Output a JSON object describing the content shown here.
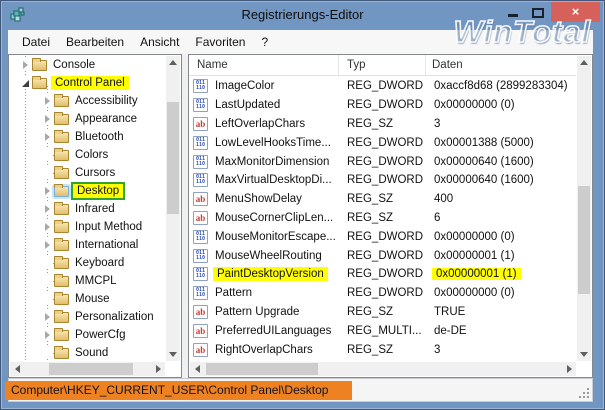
{
  "window": {
    "title": "Registrierungs-Editor",
    "watermark": "WinTotal",
    "controls": {
      "minimize": "minimize",
      "maximize": "maximize",
      "close": "×"
    }
  },
  "menu": {
    "items": [
      "Datei",
      "Bearbeiten",
      "Ansicht",
      "Favoriten",
      "?"
    ]
  },
  "tree": {
    "items": [
      {
        "label": "Console",
        "level": 1,
        "expand": "collapsed"
      },
      {
        "label": "Control Panel",
        "level": 1,
        "expand": "expanded",
        "highlight": true
      },
      {
        "label": "Accessibility",
        "level": 2,
        "expand": "collapsed"
      },
      {
        "label": "Appearance",
        "level": 2,
        "expand": "collapsed"
      },
      {
        "label": "Bluetooth",
        "level": 2,
        "expand": "collapsed"
      },
      {
        "label": "Colors",
        "level": 2,
        "expand": "none"
      },
      {
        "label": "Cursors",
        "level": 2,
        "expand": "none"
      },
      {
        "label": "Desktop",
        "level": 2,
        "expand": "collapsed",
        "highlight": true,
        "outlined": true,
        "selected": true
      },
      {
        "label": "Infrared",
        "level": 2,
        "expand": "collapsed"
      },
      {
        "label": "Input Method",
        "level": 2,
        "expand": "collapsed"
      },
      {
        "label": "International",
        "level": 2,
        "expand": "collapsed"
      },
      {
        "label": "Keyboard",
        "level": 2,
        "expand": "none"
      },
      {
        "label": "MMCPL",
        "level": 2,
        "expand": "none"
      },
      {
        "label": "Mouse",
        "level": 2,
        "expand": "none"
      },
      {
        "label": "Personalization",
        "level": 2,
        "expand": "collapsed"
      },
      {
        "label": "PowerCfg",
        "level": 2,
        "expand": "collapsed"
      },
      {
        "label": "Sound",
        "level": 2,
        "expand": "none"
      }
    ]
  },
  "list": {
    "columns": [
      "Name",
      "Typ",
      "Daten"
    ],
    "rows": [
      {
        "icon": "dword",
        "name": "ImageColor",
        "type": "REG_DWORD",
        "data": "0xaccf8d68 (2899283304)"
      },
      {
        "icon": "dword",
        "name": "LastUpdated",
        "type": "REG_DWORD",
        "data": "0x00000000 (0)"
      },
      {
        "icon": "sz",
        "name": "LeftOverlapChars",
        "type": "REG_SZ",
        "data": "3"
      },
      {
        "icon": "dword",
        "name": "LowLevelHooksTime...",
        "type": "REG_DWORD",
        "data": "0x00001388 (5000)"
      },
      {
        "icon": "dword",
        "name": "MaxMonitorDimension",
        "type": "REG_DWORD",
        "data": "0x00000640 (1600)"
      },
      {
        "icon": "dword",
        "name": "MaxVirtualDesktopDi...",
        "type": "REG_DWORD",
        "data": "0x00000640 (1600)"
      },
      {
        "icon": "sz",
        "name": "MenuShowDelay",
        "type": "REG_SZ",
        "data": "400"
      },
      {
        "icon": "sz",
        "name": "MouseCornerClipLen...",
        "type": "REG_SZ",
        "data": "6"
      },
      {
        "icon": "dword",
        "name": "MouseMonitorEscape...",
        "type": "REG_DWORD",
        "data": "0x00000000 (0)"
      },
      {
        "icon": "dword",
        "name": "MouseWheelRouting",
        "type": "REG_DWORD",
        "data": "0x00000001 (1)"
      },
      {
        "icon": "dword",
        "name": "PaintDesktopVersion",
        "type": "REG_DWORD",
        "data": "0x00000001 (1)",
        "highlight_name": true,
        "highlight_data": true
      },
      {
        "icon": "dword",
        "name": "Pattern",
        "type": "REG_DWORD",
        "data": "0x00000000 (0)"
      },
      {
        "icon": "sz",
        "name": "Pattern Upgrade",
        "type": "REG_SZ",
        "data": "TRUE"
      },
      {
        "icon": "sz",
        "name": "PreferredUILanguages",
        "type": "REG_MULTI...",
        "data": "de-DE"
      },
      {
        "icon": "sz",
        "name": "RightOverlapChars",
        "type": "REG_SZ",
        "data": "3"
      }
    ]
  },
  "statusbar": {
    "path": "Computer\\HKEY_CURRENT_USER\\Control Panel\\Desktop"
  },
  "colors": {
    "titlebar_blue": "#7296c2",
    "close_red": "#d6605a",
    "annotation_yellow": "#ffff00",
    "annotation_green": "#2fa435",
    "annotation_orange": "#ee8122"
  }
}
